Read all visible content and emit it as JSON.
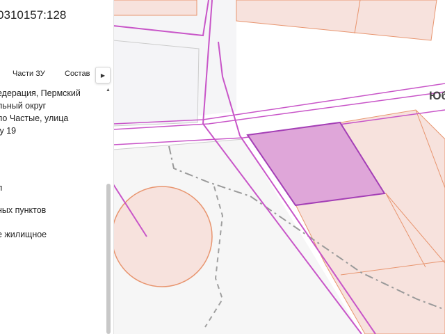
{
  "panel": {
    "cadastral_number": "0310157:128",
    "tabs": [
      {
        "label": "Части ЗУ"
      },
      {
        "label": "Состав"
      }
    ],
    "next_tab_icon": "chevron-right-icon",
    "scroll_up_icon": "triangle-up-icon",
    "address_lines": [
      "едерация, Пермский",
      "льный округ",
      "ло Частые, улица",
      "/у 19"
    ],
    "partial_text": "л",
    "category_partial": "ных пунктов",
    "use_partial": "е жилищное"
  },
  "map": {
    "street_label": "Юб",
    "colors": {
      "selected_parcel_fill": "#dfa6d9",
      "selected_parcel_border": "#a43fb6",
      "parcel_fill": "#f7e2dd",
      "parcel_border": "#e8956f",
      "road_line": "#c855c8",
      "quarter_fill": "#f5f5f7",
      "boundary_gray": "#999999"
    }
  }
}
